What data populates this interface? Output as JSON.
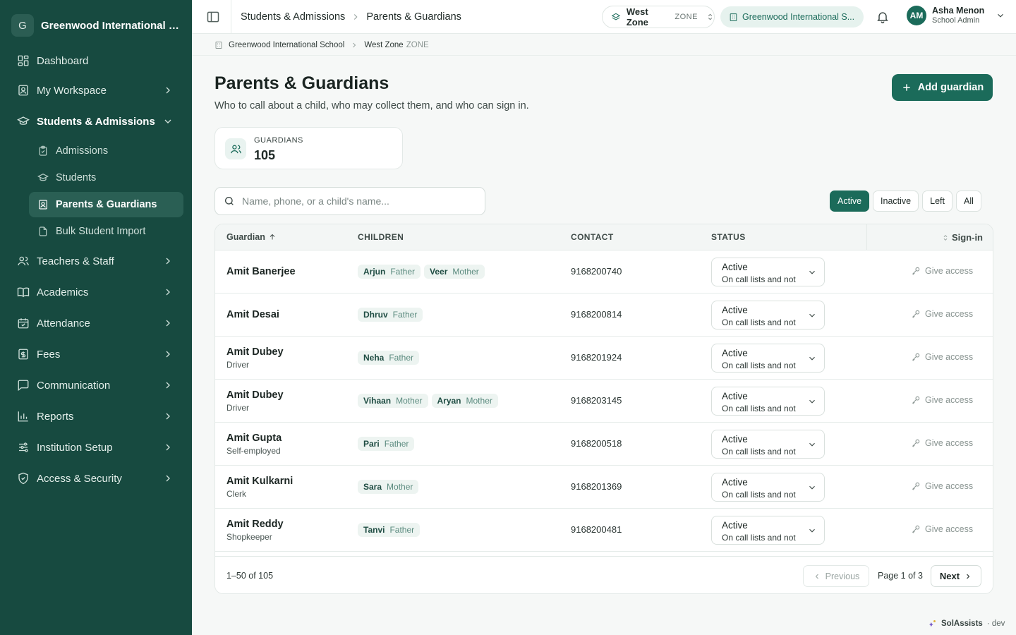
{
  "org": {
    "initial": "G",
    "name": "Greenwood International Sc..."
  },
  "sidebar": {
    "items": [
      {
        "label": "Dashboard"
      },
      {
        "label": "My Workspace"
      },
      {
        "label": "Students & Admissions"
      },
      {
        "label": "Teachers & Staff"
      },
      {
        "label": "Academics"
      },
      {
        "label": "Attendance"
      },
      {
        "label": "Fees"
      },
      {
        "label": "Communication"
      },
      {
        "label": "Reports"
      },
      {
        "label": "Institution Setup"
      },
      {
        "label": "Access & Security"
      }
    ],
    "sub_items": [
      {
        "label": "Admissions"
      },
      {
        "label": "Students"
      },
      {
        "label": "Parents & Guardians"
      },
      {
        "label": "Bulk Student Import"
      }
    ]
  },
  "header": {
    "breadcrumb": [
      "Students & Admissions",
      "Parents & Guardians"
    ],
    "zone_name": "West Zone",
    "zone_label": "ZONE",
    "school": "Greenwood International S...",
    "user_initials": "AM",
    "user_name": "Asha Menon",
    "user_role": "School Admin"
  },
  "subcrumb": {
    "school": "Greenwood International School",
    "zone": "West Zone",
    "zone_label": "ZONE"
  },
  "page": {
    "title": "Parents & Guardians",
    "subtitle": "Who to call about a child, who may collect them, and who can sign in.",
    "add_label": "Add guardian"
  },
  "stat": {
    "label": "GUARDIANS",
    "value": "105"
  },
  "search": {
    "placeholder": "Name, phone, or a child's name..."
  },
  "filters": [
    {
      "label": "Active",
      "selected": true
    },
    {
      "label": "Inactive",
      "selected": false
    },
    {
      "label": "Left",
      "selected": false
    },
    {
      "label": "All",
      "selected": false
    }
  ],
  "table": {
    "columns": [
      "Guardian",
      "CHILDREN",
      "CONTACT",
      "STATUS",
      "Sign-in"
    ],
    "rows": [
      {
        "name": "Amit Banerjee",
        "role": "",
        "children": [
          {
            "name": "Arjun",
            "rel": "Father"
          },
          {
            "name": "Veer",
            "rel": "Mother"
          }
        ],
        "contact": "9168200740",
        "status": "Active",
        "status_desc": "On call lists and not",
        "access": "Give access"
      },
      {
        "name": "Amit Desai",
        "role": "",
        "children": [
          {
            "name": "Dhruv",
            "rel": "Father"
          }
        ],
        "contact": "9168200814",
        "status": "Active",
        "status_desc": "On call lists and not",
        "access": "Give access"
      },
      {
        "name": "Amit Dubey",
        "role": "Driver",
        "children": [
          {
            "name": "Neha",
            "rel": "Father"
          }
        ],
        "contact": "9168201924",
        "status": "Active",
        "status_desc": "On call lists and not",
        "access": "Give access"
      },
      {
        "name": "Amit Dubey",
        "role": "Driver",
        "children": [
          {
            "name": "Vihaan",
            "rel": "Mother"
          },
          {
            "name": "Aryan",
            "rel": "Mother"
          }
        ],
        "contact": "9168203145",
        "status": "Active",
        "status_desc": "On call lists and not",
        "access": "Give access"
      },
      {
        "name": "Amit Gupta",
        "role": "Self-employed",
        "children": [
          {
            "name": "Pari",
            "rel": "Father"
          }
        ],
        "contact": "9168200518",
        "status": "Active",
        "status_desc": "On call lists and not",
        "access": "Give access"
      },
      {
        "name": "Amit Kulkarni",
        "role": "Clerk",
        "children": [
          {
            "name": "Sara",
            "rel": "Mother"
          }
        ],
        "contact": "9168201369",
        "status": "Active",
        "status_desc": "On call lists and not",
        "access": "Give access"
      },
      {
        "name": "Amit Reddy",
        "role": "Shopkeeper",
        "children": [
          {
            "name": "Tanvi",
            "rel": "Father"
          }
        ],
        "contact": "9168200481",
        "status": "Active",
        "status_desc": "On call lists and not",
        "access": "Give access"
      }
    ]
  },
  "pagination": {
    "count": "1–50 of 105",
    "previous": "Previous",
    "page": "Page 1 of 3",
    "next": "Next"
  },
  "footer": {
    "brand": "SolAssists",
    "env": "· dev"
  },
  "colors": {
    "sidebar": "#174a40",
    "accent": "#1b6b5a",
    "active_sub": "#2a5f54"
  }
}
